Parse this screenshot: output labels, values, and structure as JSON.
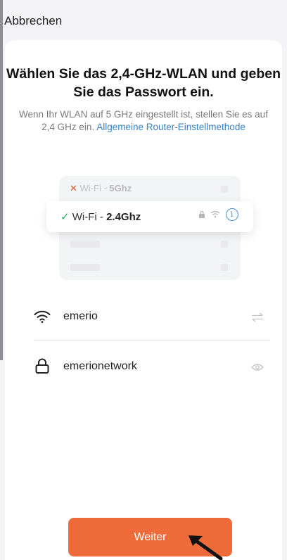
{
  "header": {
    "cancel_label": "Abbrechen"
  },
  "title": "Wählen Sie das 2,4-GHz-WLAN und geben Sie das Passwort ein.",
  "description": {
    "text": "Wenn Ihr WLAN auf 5 GHz eingestellt ist, stellen Sie es auf 2,4 GHz ein.",
    "link": "Allgemeine Router-Einstellmethode"
  },
  "illustration": {
    "row_5ghz": {
      "prefix": "Wi-Fi - ",
      "band": "5Ghz"
    },
    "row_24ghz": {
      "prefix": "Wi-Fi - ",
      "band": "2.4Ghz"
    }
  },
  "form": {
    "ssid": "emerio",
    "password": "emerionetwork"
  },
  "footer": {
    "next_label": "Weiter"
  },
  "colors": {
    "accent": "#ef6b3a",
    "link": "#3b82c4",
    "check": "#27ae60",
    "cross": "#e4572e"
  }
}
